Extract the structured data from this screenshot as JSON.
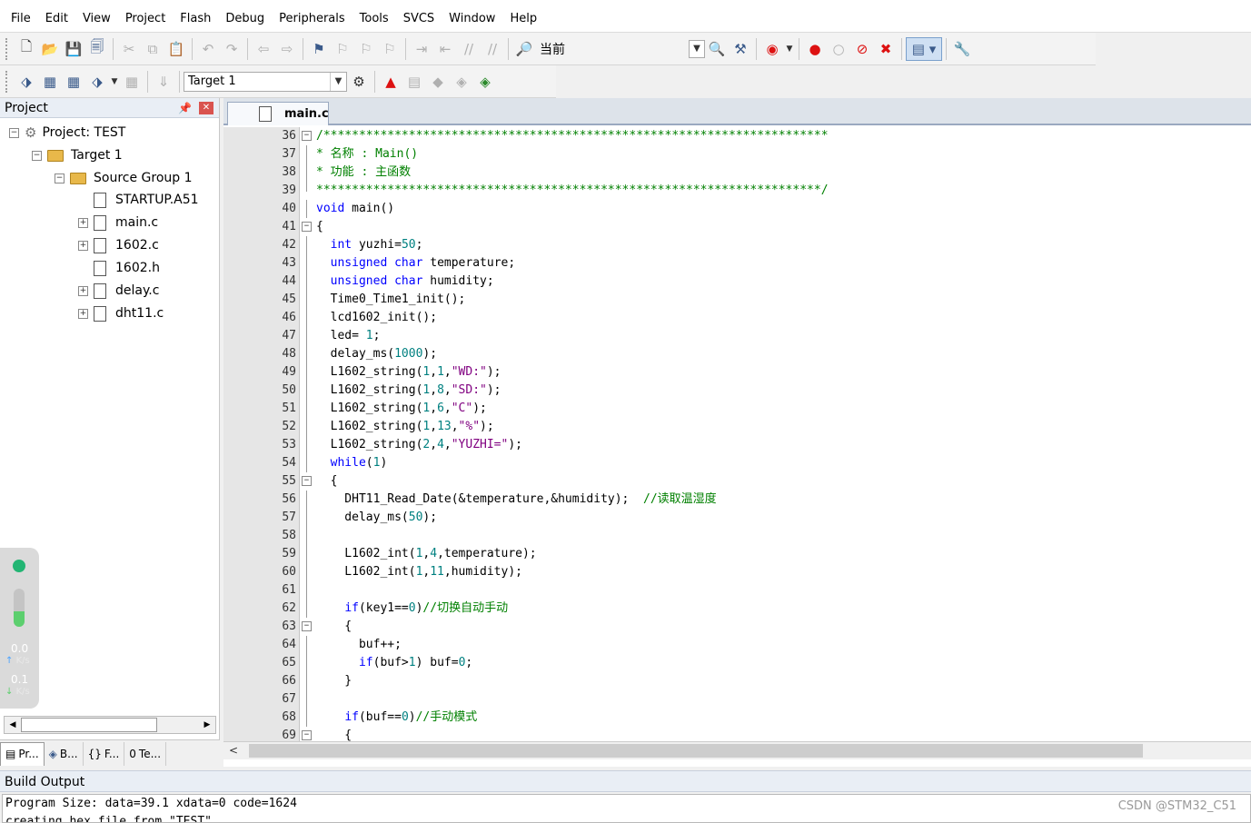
{
  "menu": [
    "File",
    "Edit",
    "View",
    "Project",
    "Flash",
    "Debug",
    "Peripherals",
    "Tools",
    "SVCS",
    "Window",
    "Help"
  ],
  "toolbar": {
    "find_label": "当前"
  },
  "build_toolbar": {
    "target_select": "Target 1"
  },
  "project_panel": {
    "title": "Project",
    "tree": [
      {
        "label": "Project: TEST"
      },
      {
        "label": "Target 1"
      },
      {
        "label": "Source Group 1"
      },
      {
        "label": "STARTUP.A51"
      },
      {
        "label": "main.c"
      },
      {
        "label": "1602.c"
      },
      {
        "label": "1602.h"
      },
      {
        "label": "delay.c"
      },
      {
        "label": "dht11.c"
      }
    ],
    "bottom_tabs": [
      {
        "label": "Pr..."
      },
      {
        "label": "B..."
      },
      {
        "label": "F..."
      },
      {
        "label": "Te..."
      }
    ]
  },
  "network_widget": {
    "upload_value": "0.0",
    "download_value": "0.1",
    "unit": "K/s",
    "level": 0.4
  },
  "editor": {
    "tab": "main.c",
    "lines": [
      {
        "n": "36",
        "html": "<span class=\"cmt\">/***********************************************************************</span>"
      },
      {
        "n": "37",
        "html": "<span class=\"cmt\">* 名称 : Main()</span>"
      },
      {
        "n": "38",
        "html": "<span class=\"cmt\">* 功能 : 主函数</span>"
      },
      {
        "n": "39",
        "html": "<span class=\"cmt\">***********************************************************************/</span>"
      },
      {
        "n": "40",
        "html": "<span class=\"kw\">void</span> main()"
      },
      {
        "n": "41",
        "html": "{"
      },
      {
        "n": "42",
        "html": "  <span class=\"kw\">int</span> yuzhi=<span class=\"num\">50</span>;"
      },
      {
        "n": "43",
        "html": "  <span class=\"kw\">unsigned</span> <span class=\"kw\">char</span> temperature;"
      },
      {
        "n": "44",
        "html": "  <span class=\"kw\">unsigned</span> <span class=\"kw\">char</span> humidity;"
      },
      {
        "n": "45",
        "html": "  Time0_Time1_init();"
      },
      {
        "n": "46",
        "html": "  lcd1602_init();"
      },
      {
        "n": "47",
        "html": "  led= <span class=\"num\">1</span>;"
      },
      {
        "n": "48",
        "html": "  delay_ms(<span class=\"num\">1000</span>);"
      },
      {
        "n": "49",
        "html": "  L1602_string(<span class=\"num\">1</span>,<span class=\"num\">1</span>,<span class=\"str\">\"WD:\"</span>);"
      },
      {
        "n": "50",
        "html": "  L1602_string(<span class=\"num\">1</span>,<span class=\"num\">8</span>,<span class=\"str\">\"SD:\"</span>);"
      },
      {
        "n": "51",
        "html": "  L1602_string(<span class=\"num\">1</span>,<span class=\"num\">6</span>,<span class=\"str\">\"C\"</span>);"
      },
      {
        "n": "52",
        "html": "  L1602_string(<span class=\"num\">1</span>,<span class=\"num\">13</span>,<span class=\"str\">\"%\"</span>);"
      },
      {
        "n": "53",
        "html": "  L1602_string(<span class=\"num\">2</span>,<span class=\"num\">4</span>,<span class=\"str\">\"YUZHI=\"</span>);"
      },
      {
        "n": "54",
        "html": "  <span class=\"kw\">while</span>(<span class=\"num\">1</span>)"
      },
      {
        "n": "55",
        "html": "  {"
      },
      {
        "n": "56",
        "html": "    DHT11_Read_Date(&amp;temperature,&amp;humidity);  <span class=\"cmt\">//读取温湿度</span>"
      },
      {
        "n": "57",
        "html": "    delay_ms(<span class=\"num\">50</span>);"
      },
      {
        "n": "58",
        "html": ""
      },
      {
        "n": "59",
        "html": "    L1602_int(<span class=\"num\">1</span>,<span class=\"num\">4</span>,temperature);"
      },
      {
        "n": "60",
        "html": "    L1602_int(<span class=\"num\">1</span>,<span class=\"num\">11</span>,humidity);"
      },
      {
        "n": "61",
        "html": ""
      },
      {
        "n": "62",
        "html": "    <span class=\"kw\">if</span>(key1==<span class=\"num\">0</span>)<span class=\"cmt\">//切换自动手动</span>"
      },
      {
        "n": "63",
        "html": "    {"
      },
      {
        "n": "64",
        "html": "      buf++;"
      },
      {
        "n": "65",
        "html": "      <span class=\"kw\">if</span>(buf&gt;<span class=\"num\">1</span>) buf=<span class=\"num\">0</span>;"
      },
      {
        "n": "66",
        "html": "    }"
      },
      {
        "n": "67",
        "html": ""
      },
      {
        "n": "68",
        "html": "    <span class=\"kw\">if</span>(buf==<span class=\"num\">0</span>)<span class=\"cmt\">//手动模式</span>"
      },
      {
        "n": "69",
        "html": "    {"
      }
    ]
  },
  "build_output": {
    "title": "Build Output",
    "lines": [
      "Program Size: data=39.1 xdata=0 code=1624",
      "creating hex file from \"TEST\"..."
    ]
  },
  "watermark": "CSDN @STM32_C51"
}
